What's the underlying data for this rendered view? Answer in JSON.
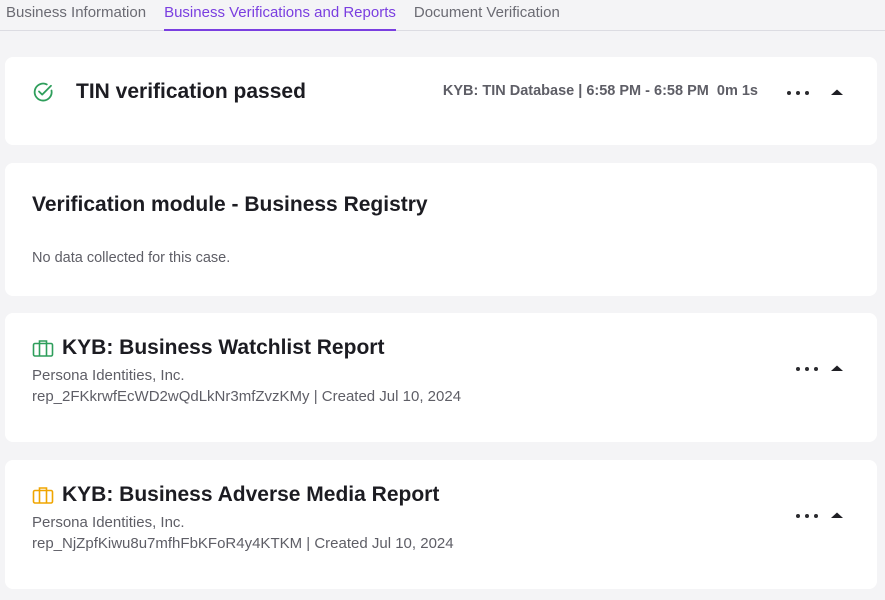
{
  "tabs": [
    {
      "label": "Business Information"
    },
    {
      "label": "Business Verifications and Reports"
    },
    {
      "label": "Document Verification"
    }
  ],
  "tin_card": {
    "icon": "check-circle-icon",
    "title": "TIN verification passed",
    "meta": "KYB: TIN Database | 6:58 PM - 6:58 PM  0m 1s",
    "status_color": "#2e9e5b"
  },
  "module_card": {
    "title": "Verification module - Business Registry",
    "empty_text": "No data collected for this case."
  },
  "reports": [
    {
      "icon": "briefcase-icon",
      "icon_color": "#2e9e5b",
      "title": "KYB: Business Watchlist Report",
      "company": "Persona Identities, Inc.",
      "ref_line": "rep_2FKkrwfEcWD2wQdLkNr3mfZvzKMy | Created Jul 10, 2024"
    },
    {
      "icon": "briefcase-icon",
      "icon_color": "#f0a500",
      "title": "KYB: Business Adverse Media Report",
      "company": "Persona Identities, Inc.",
      "ref_line": "rep_NjZpfKiwu8u7mfhFbKFoR4y4KTKM | Created Jul 10, 2024"
    }
  ],
  "accent_color": "#7a3ee0"
}
